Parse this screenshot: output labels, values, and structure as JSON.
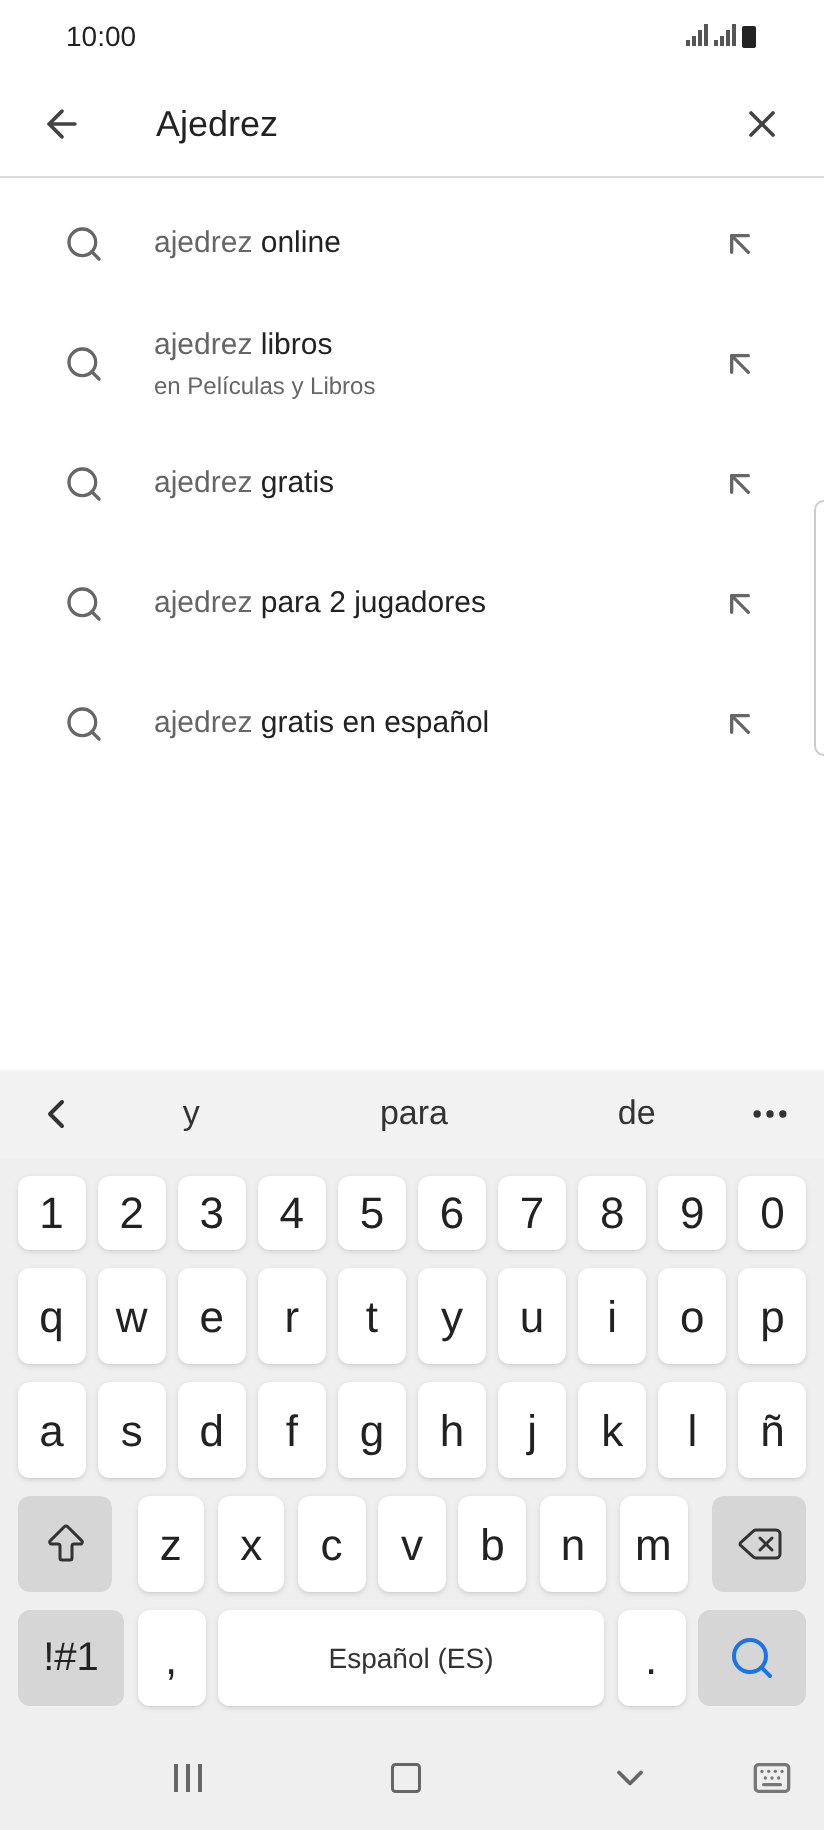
{
  "status_bar": {
    "time": "10:00"
  },
  "search": {
    "value": "Ajedrez"
  },
  "suggestions": [
    {
      "prefix": "ajedrez",
      "completion": "online"
    },
    {
      "prefix": "ajedrez",
      "completion": "libros",
      "subtitle": "en Películas y Libros"
    },
    {
      "prefix": "ajedrez",
      "completion": "gratis"
    },
    {
      "prefix": "ajedrez",
      "completion": "para 2 jugadores"
    },
    {
      "prefix": "ajedrez",
      "completion": "gratis en español"
    }
  ],
  "keyboard": {
    "predictions": [
      "y",
      "para",
      "de"
    ],
    "key_rows": [
      {
        "keys": [
          {
            "kind": "char",
            "label": "1"
          },
          {
            "kind": "char",
            "label": "2"
          },
          {
            "kind": "char",
            "label": "3"
          },
          {
            "kind": "char",
            "label": "4"
          },
          {
            "kind": "char",
            "label": "5"
          },
          {
            "kind": "char",
            "label": "6"
          },
          {
            "kind": "char",
            "label": "7"
          },
          {
            "kind": "char",
            "label": "8"
          },
          {
            "kind": "char",
            "label": "9"
          },
          {
            "kind": "char",
            "label": "0"
          }
        ]
      },
      {
        "keys": [
          {
            "kind": "char",
            "label": "q"
          },
          {
            "kind": "char",
            "label": "w"
          },
          {
            "kind": "char",
            "label": "e"
          },
          {
            "kind": "char",
            "label": "r"
          },
          {
            "kind": "char",
            "label": "t"
          },
          {
            "kind": "char",
            "label": "y"
          },
          {
            "kind": "char",
            "label": "u"
          },
          {
            "kind": "char",
            "label": "i"
          },
          {
            "kind": "char",
            "label": "o"
          },
          {
            "kind": "char",
            "label": "p"
          }
        ]
      },
      {
        "keys": [
          {
            "kind": "char",
            "label": "a"
          },
          {
            "kind": "char",
            "label": "s"
          },
          {
            "kind": "char",
            "label": "d"
          },
          {
            "kind": "char",
            "label": "f"
          },
          {
            "kind": "char",
            "label": "g"
          },
          {
            "kind": "char",
            "label": "h"
          },
          {
            "kind": "char",
            "label": "j"
          },
          {
            "kind": "char",
            "label": "k"
          },
          {
            "kind": "char",
            "label": "l"
          },
          {
            "kind": "char",
            "label": "ñ"
          }
        ]
      },
      {
        "keys": [
          {
            "kind": "shift"
          },
          {
            "kind": "char",
            "label": "z"
          },
          {
            "kind": "char",
            "label": "x"
          },
          {
            "kind": "char",
            "label": "c"
          },
          {
            "kind": "char",
            "label": "v"
          },
          {
            "kind": "char",
            "label": "b"
          },
          {
            "kind": "char",
            "label": "n"
          },
          {
            "kind": "char",
            "label": "m"
          },
          {
            "kind": "backspace"
          }
        ]
      },
      {
        "keys": [
          {
            "kind": "symbols",
            "label": "!#1"
          },
          {
            "kind": "char",
            "label": ","
          },
          {
            "kind": "space",
            "label": "Español (ES)"
          },
          {
            "kind": "char",
            "label": "."
          },
          {
            "kind": "search"
          }
        ]
      }
    ]
  }
}
